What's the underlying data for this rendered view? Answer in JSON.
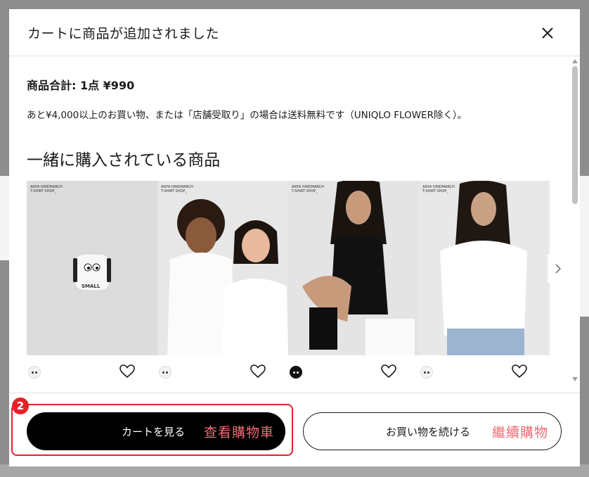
{
  "modal": {
    "title": "カートに商品が追加されました",
    "total": "商品合計: 1点 ¥990",
    "notice": "あと¥4,000以上のお買い物、または「店舗受取り」の場合は送料無料です（UNIQLO FLOWER除く）。",
    "section_title": "一緒に購入されている商品"
  },
  "products": [
    {
      "brand_line1": "ANYA HINDMARCH",
      "brand_line2": "T-SHIRT SHOP_"
    },
    {
      "brand_line1": "ANYA HINDMARCH",
      "brand_line2": "T-SHIRT SHOP_"
    },
    {
      "brand_line1": "ANYA HINDMARCH",
      "brand_line2": "T-SHIRT SHOP_"
    },
    {
      "brand_line1": "ANYA HINDMARCH",
      "brand_line2": "T-SHIRT SHOP_"
    }
  ],
  "footer": {
    "view_cart": "カートを見る",
    "view_cart_zh": "查看購物車",
    "continue": "お買い物を続ける",
    "continue_zh": "繼續購物"
  },
  "annotation": {
    "step": "2"
  },
  "colors": {
    "accent_red": "#e5222a",
    "zh_label": "#f06b73",
    "primary": "#000000"
  }
}
